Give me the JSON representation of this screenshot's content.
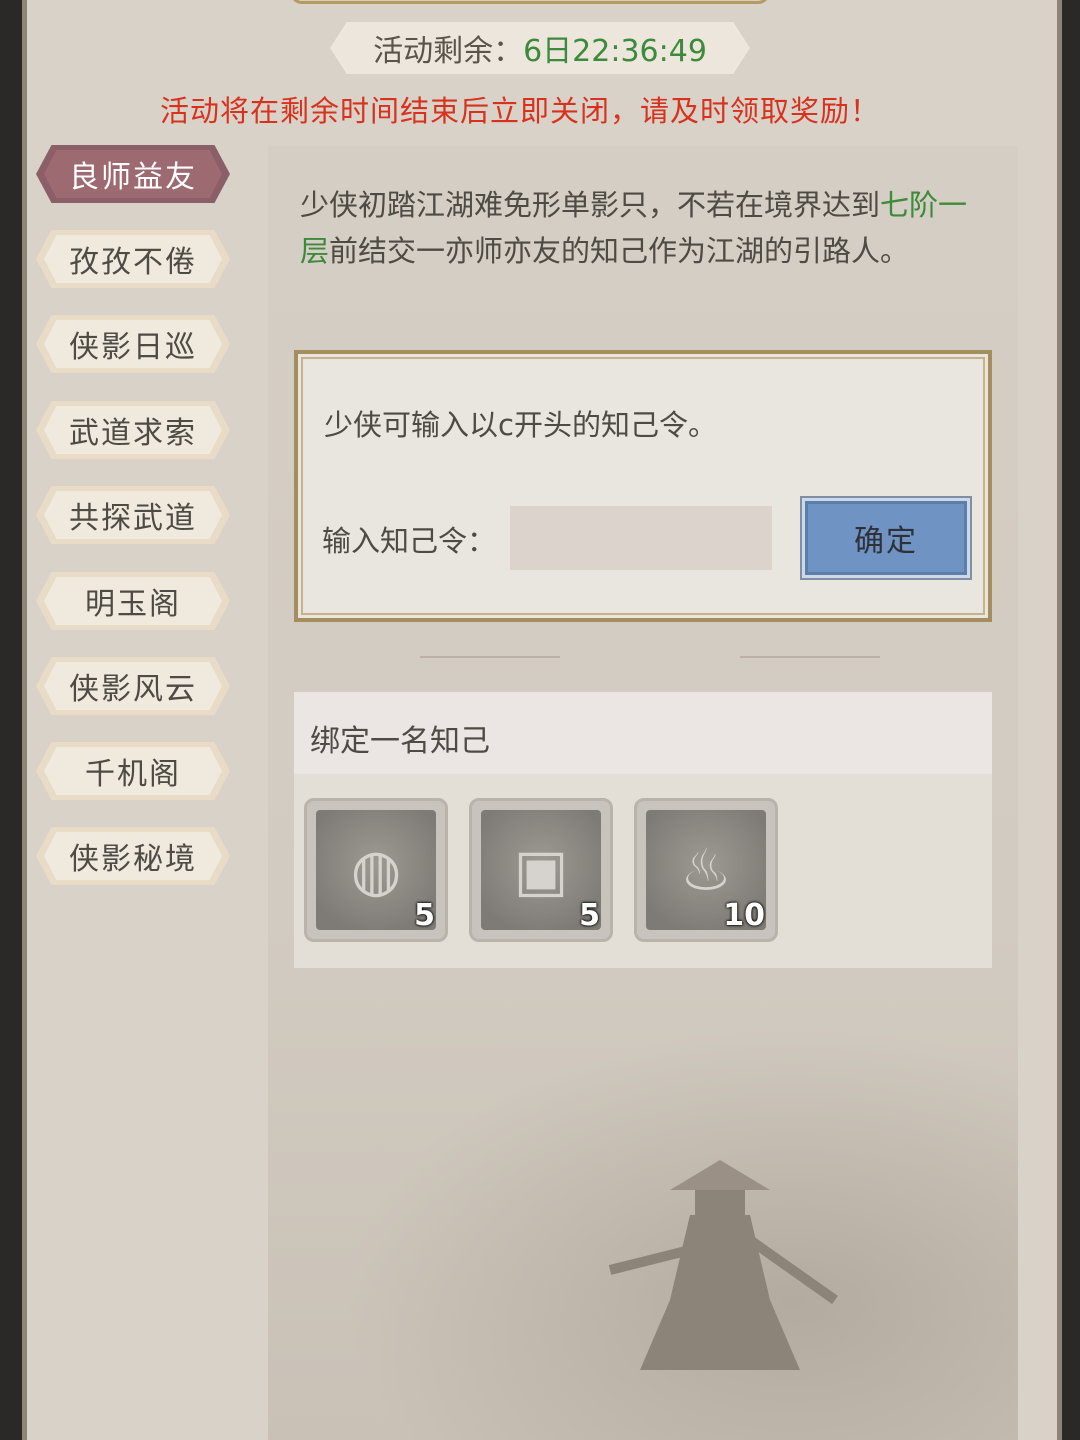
{
  "timer": {
    "label": "活动剩余：",
    "value": "6日22:36:49"
  },
  "notice": "活动将在剩余时间结束后立即关闭，请及时领取奖励！",
  "sidebar": {
    "items": [
      {
        "label": "良师益友",
        "active": true
      },
      {
        "label": "孜孜不倦",
        "active": false
      },
      {
        "label": "侠影日巡",
        "active": false
      },
      {
        "label": "武道求索",
        "active": false
      },
      {
        "label": "共探武道",
        "active": false
      },
      {
        "label": "明玉阁",
        "active": false
      },
      {
        "label": "侠影风云",
        "active": false
      },
      {
        "label": "千机阁",
        "active": false
      },
      {
        "label": "侠影秘境",
        "active": false
      }
    ]
  },
  "main": {
    "desc_part1": "少侠初踏江湖难免形单影只，不若在境界达到",
    "desc_highlight": "七阶一层",
    "desc_part2": "前结交一亦师亦友的知己作为江湖的引路人。",
    "code_hint": "少侠可输入以c开头的知己令。",
    "code_label": "输入知己令：",
    "code_value": "",
    "confirm_label": "确定",
    "bind_title": "绑定一名知己",
    "rewards": [
      {
        "icon": "jade-orb-icon",
        "count": "5"
      },
      {
        "icon": "treasure-chest-icon",
        "count": "5"
      },
      {
        "icon": "incense-burner-icon",
        "count": "10"
      }
    ]
  },
  "colors": {
    "highlight_green": "#3c8a3a",
    "notice_red": "#d8321e",
    "active_tab": "#9d6a72",
    "confirm_blue": "#6f93c2"
  }
}
